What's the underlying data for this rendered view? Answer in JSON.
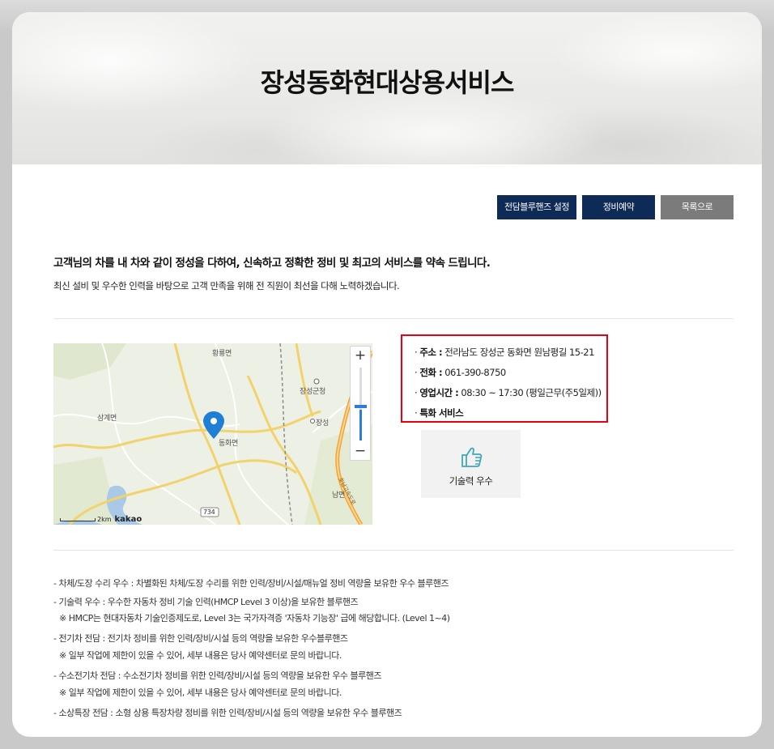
{
  "page": {
    "title": "장성동화현대상용서비스"
  },
  "buttons": {
    "bluehands_setting": "전담블루핸즈 설정",
    "reservation": "정비예약",
    "back_to_list": "목록으로"
  },
  "intro": {
    "headline": "고객님의 차를 내 차와 같이 정성을 다하여, 신속하고 정확한 정비 및 최고의 서비스를 약속 드립니다.",
    "body": "최신 설비 및 우수한 인력을 바탕으로 고객 만족을 위해 전 직원이 최선을 다해 노력하겠습니다."
  },
  "map": {
    "labels": {
      "hwangryong": "황룡면",
      "jangseong_office": "장성군청",
      "samgye": "삼계면",
      "donghwa": "동화면",
      "jangseong_ic": "장성",
      "nam": "남면",
      "route": "734",
      "highway": "호남고속도로"
    },
    "zoom_in": "+",
    "zoom_out": "−",
    "zoom_level": 0.42,
    "scale": "2km",
    "provider": "kakao"
  },
  "info": {
    "address_key": "주소 :",
    "address_value": "전라남도 장성군 동화면 원남평길 15-21",
    "phone_key": "전화 :",
    "phone_value": "061-390-8750",
    "hours_key": "영업시간 :",
    "hours_value": "08:30 ~ 17:30 (평일근무(주5일제))",
    "service_key": "특화 서비스",
    "bullet": "·"
  },
  "badge": {
    "icon": "thumbs-up-icon",
    "label": "기술력 우수"
  },
  "notes": [
    "- 차체/도장 수리 우수 : 차별화된 차체/도장 수리를 위한 인력/장비/시설/매뉴얼 정비 역량을 보유한 우수 블루핸즈",
    "- 기술력 우수 : 우수한 자동차 정비 기술 인력(HMCP Level 3 이상)을 보유한 블루핸즈",
    "※ HMCP는 현대자동차 기술인증제도로, Level 3는 국가자격증 '자동차 기능장' 급에 해당합니다. (Level 1~4)",
    "- 전기차 전담 : 전기차 정비를 위한 인력/장비/시설 등의 역량을 보유한 우수블루핸즈",
    "※ 일부 작업에 제한이 있을 수 있어, 세부 내용은 당사 예약센터로 문의 바랍니다.",
    "- 수소전기차 전담 : 수소전기차 정비를 위한 인력/장비/시설 등의 역량을 보유한 우수 블루핸즈",
    "※ 일부 작업에 제한이 있을 수 있어, 세부 내용은 당사 예약센터로 문의 바랍니다.",
    "- 소상특장 전담 : 소형 상용 특장차량 정비를 위한 인력/장비/시설 등의 역량을 보유한 우수 블루핸즈"
  ],
  "colors": {
    "navy": "#0e2a57",
    "gray_button": "#7b7b7b",
    "highlight_border": "#e60012",
    "marker": "#1f7fd6"
  }
}
